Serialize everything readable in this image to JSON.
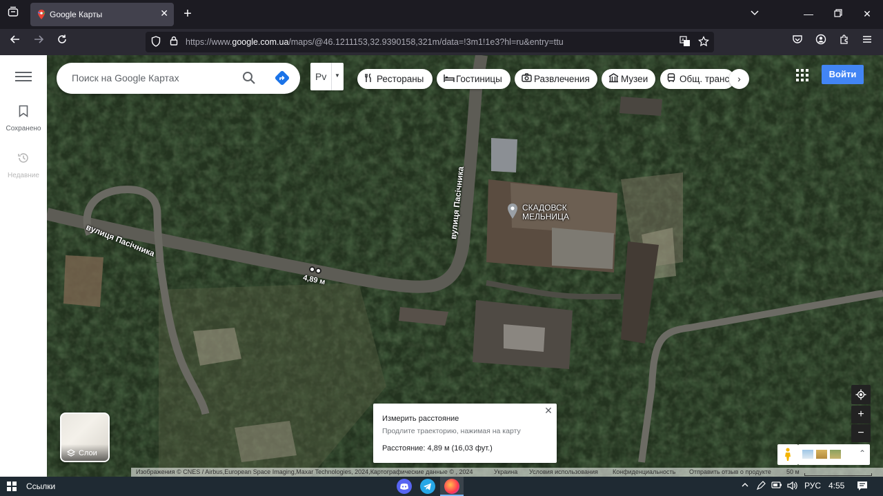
{
  "browser": {
    "tab": {
      "title": "Google Карты"
    },
    "url": {
      "prefix": "https://www.",
      "domain": "google.com.ua",
      "path": "/maps/@46.1211153,32.9390158,321m/data=!3m1!1e3?hl=ru&entry=ttu"
    },
    "icons": {
      "tab_list": "tab-list-icon",
      "new_tab": "plus-icon",
      "back": "back-arrow-icon",
      "forward": "forward-arrow-icon",
      "reload": "reload-icon",
      "shield": "shield-icon",
      "lock": "lock-icon",
      "translate": "translate-icon",
      "bookmark": "star-icon",
      "pocket": "pocket-icon",
      "account": "account-icon",
      "extensions": "puzzle-icon",
      "menu": "hamburger-icon"
    }
  },
  "maps": {
    "rail": {
      "saved": "Сохранено",
      "recent": "Недавние"
    },
    "search": {
      "placeholder": "Поиск на Google Картах"
    },
    "language": {
      "label": "Рv"
    },
    "chips": [
      {
        "label": "Рестораны",
        "icon": "fork-knife-icon"
      },
      {
        "label": "Гостиницы",
        "icon": "bed-icon"
      },
      {
        "label": "Развлечения",
        "icon": "camera-icon"
      },
      {
        "label": "Музеи",
        "icon": "museum-icon"
      },
      {
        "label": "Общ. транспорт",
        "icon": "bus-icon"
      }
    ],
    "signin": "Войти",
    "map": {
      "street_1": "вулиця Пасічника",
      "street_2": "вулиця Пасічника",
      "poi": "СКАДОВСК МЕЛЬНИЦА",
      "measure_label": "4,89 м"
    },
    "layers": {
      "label": "Слои"
    },
    "measure_card": {
      "title": "Измерить расстояние",
      "hint": "Продлите траекторию, нажимая на карту",
      "distance": "Расстояние: 4,89 м (16,03 фут.)"
    },
    "attribution": {
      "imagery": "Изображения © CNES / Airbus,European Space Imaging,Maxar Technologies, 2024,Картографические данные © , 2024",
      "country": "Украина",
      "terms": "Условия использования",
      "privacy": "Конфиденциальность",
      "feedback": "Отправить отзыв о продукте",
      "scale": "50 м"
    },
    "controls": {
      "locate": "my-location-icon",
      "zoom_in": "+",
      "zoom_out": "−",
      "expand": "⌃"
    }
  },
  "taskbar": {
    "links": "Ссылки",
    "apps": [
      "discord-icon",
      "telegram-icon",
      "firefox-icon"
    ],
    "language": "РУС",
    "time": "4:55"
  },
  "colors": {
    "tab_bg": "#42414d",
    "accent": "#4285f4",
    "taskbar": "#1f2a33"
  }
}
